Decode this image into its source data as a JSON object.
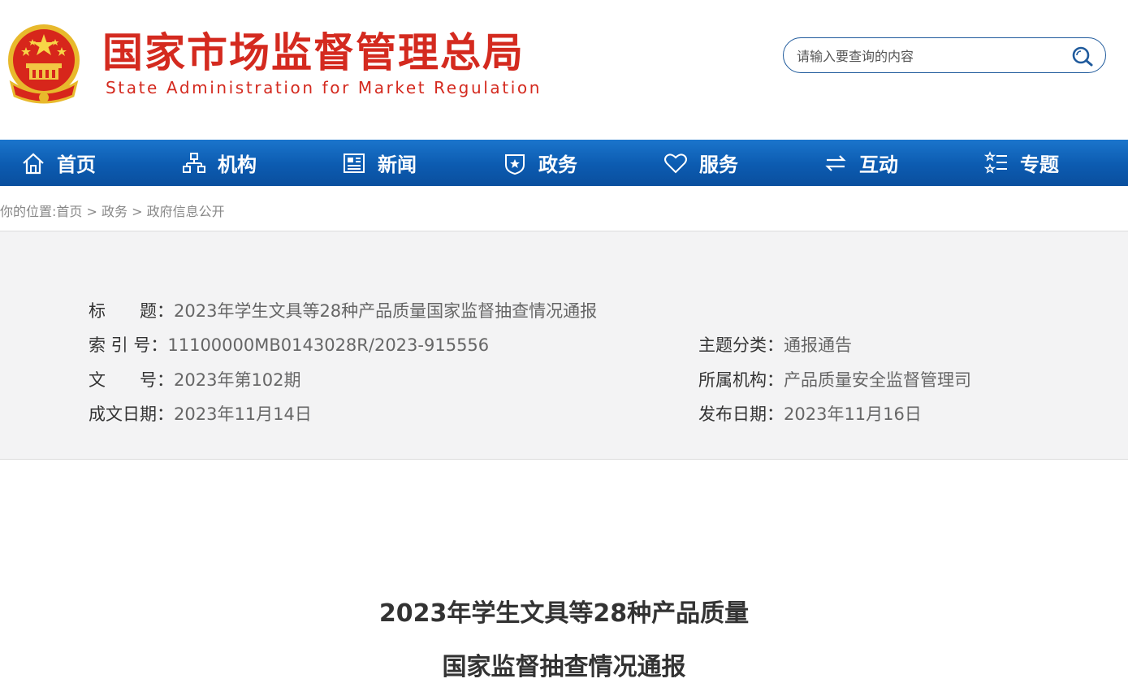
{
  "header": {
    "title_cn": "国家市场监督管理总局",
    "title_en": "State Administration for Market Regulation",
    "search_placeholder": "请输入要查询的内容",
    "search_icon": "search-icon",
    "brand_color": "#d42a1f"
  },
  "nav": {
    "color": "#0c5bb0",
    "items": [
      {
        "label": "首页",
        "icon": "home-icon"
      },
      {
        "label": "机构",
        "icon": "org-chart-icon"
      },
      {
        "label": "新闻",
        "icon": "newspaper-icon"
      },
      {
        "label": "政务",
        "icon": "shield-star-icon"
      },
      {
        "label": "服务",
        "icon": "heart-icon"
      },
      {
        "label": "互动",
        "icon": "swap-arrows-icon"
      },
      {
        "label": "专题",
        "icon": "star-list-icon"
      }
    ]
  },
  "breadcrumb": {
    "prefix": "你的位置:",
    "items": [
      "首页",
      "政务",
      "政府信息公开"
    ],
    "separator": ">"
  },
  "meta": {
    "title_label": "标　　题：",
    "title_value": "2023年学生文具等28种产品质量国家监督抽查情况通报",
    "index_label": "索 引 号：",
    "index_value": "11100000MB0143028R/2023-915556",
    "topic_label": "主题分类：",
    "topic_value": "通报通告",
    "docno_label": "文　　号：",
    "docno_value": "2023年第102期",
    "org_label": "所属机构：",
    "org_value": "产品质量安全监督管理司",
    "written_label": "成文日期：",
    "written_value": "2023年11月14日",
    "published_label": "发布日期：",
    "published_value": "2023年11月16日"
  },
  "article": {
    "title_line1": "2023年学生文具等28种产品质量",
    "title_line2": "国家监督抽查情况通报"
  }
}
